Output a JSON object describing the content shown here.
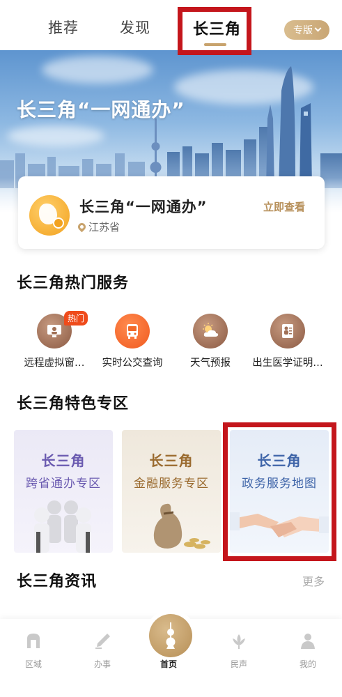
{
  "top_tabs": [
    {
      "label": "推荐"
    },
    {
      "label": "发现"
    },
    {
      "label": "长三角",
      "active": true
    }
  ],
  "edition_button": {
    "label": "专版",
    "icon": "chevron-down-icon"
  },
  "banner": {
    "title": "长三角“一网通办”"
  },
  "gov_card": {
    "title": "长三角“一网通办”",
    "location": "江苏省",
    "action": "立即查看"
  },
  "hot_services": {
    "title": "长三角热门服务",
    "items": [
      {
        "label": "远程虚拟窗…",
        "icon": "virtual-window-icon",
        "badge": "热门"
      },
      {
        "label": "实时公交查询",
        "icon": "bus-icon"
      },
      {
        "label": "天气预报",
        "icon": "weather-icon"
      },
      {
        "label": "出生医学证明…",
        "icon": "certificate-icon"
      }
    ]
  },
  "feature_zone": {
    "title": "长三角特色专区",
    "tiles": [
      {
        "title": "长三角",
        "subtitle": "跨省通办专区"
      },
      {
        "title": "长三角",
        "subtitle": "金融服务专区"
      },
      {
        "title": "长三角",
        "subtitle": "政务服务地图"
      }
    ]
  },
  "news": {
    "title": "长三角资讯",
    "more": "更多"
  },
  "bottom_nav": [
    {
      "label": "区域",
      "icon": "region-icon"
    },
    {
      "label": "办事",
      "icon": "pen-icon"
    },
    {
      "label": "首页",
      "icon": "tower-icon",
      "active": true
    },
    {
      "label": "民声",
      "icon": "lotus-icon"
    },
    {
      "label": "我的",
      "icon": "person-icon"
    }
  ],
  "colors": {
    "accent_gold": "#c8a36d",
    "highlight_red": "#c4161c",
    "hot_badge": "#ef4b1b"
  }
}
